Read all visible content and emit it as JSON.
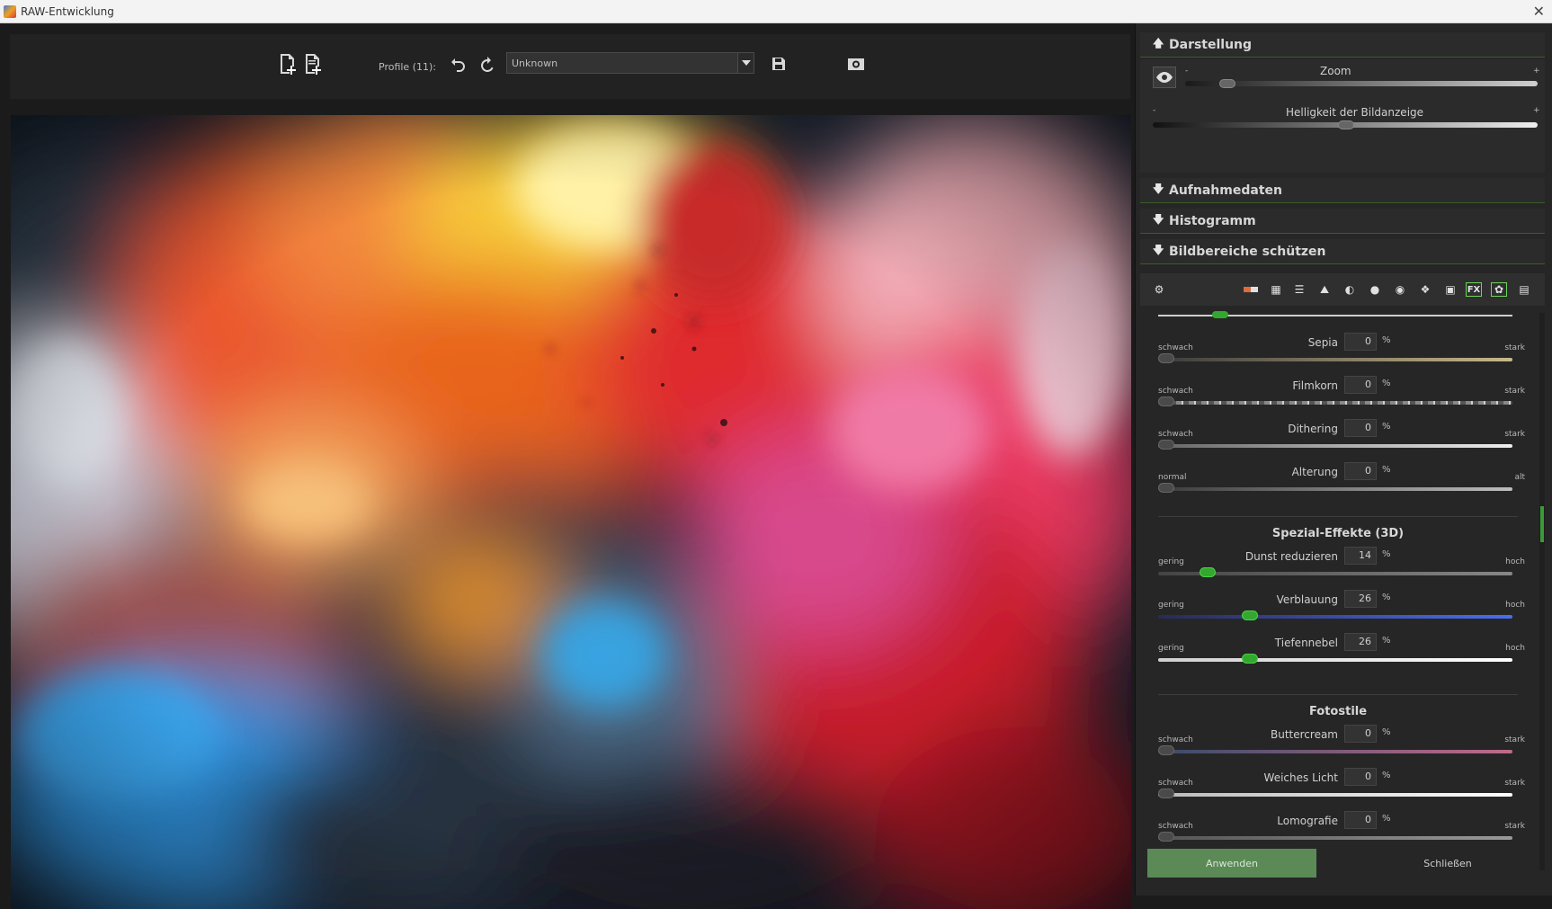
{
  "window": {
    "title": "RAW-Entwicklung",
    "close_glyph": "✕"
  },
  "toolbar": {
    "profile_label": "Profile (11):",
    "profile_value": "Unknown",
    "icons": [
      "add-file-icon",
      "add-copy-icon",
      "undo-icon",
      "redo-icon",
      "save-icon",
      "camera-icon"
    ]
  },
  "panel": {
    "darstellung": {
      "title": "Darstellung",
      "zoom_label": "Zoom",
      "zoom_minus": "-",
      "zoom_plus": "+",
      "brightness_label": "Helligkeit der Bildanzeige",
      "brightness_minus": "-",
      "brightness_plus": "+"
    },
    "aufnahmedaten": {
      "title": "Aufnahmedaten"
    },
    "histogramm": {
      "title": "Histogramm"
    },
    "bildbereiche": {
      "title": "Bildbereiche schützen"
    },
    "effects": [
      {
        "name": "Sepia",
        "value": "0",
        "unit": "%",
        "low": "schwach",
        "high": "stark",
        "level": 0
      },
      {
        "name": "Filmkorn",
        "value": "0",
        "unit": "%",
        "low": "schwach",
        "high": "stark",
        "level": 0
      },
      {
        "name": "Dithering",
        "value": "0",
        "unit": "%",
        "low": "schwach",
        "high": "stark",
        "level": 0
      },
      {
        "name": "Alterung",
        "value": "0",
        "unit": "%",
        "low": "normal",
        "high": "alt",
        "level": 0
      }
    ],
    "special_title": "Spezial-Effekte (3D)",
    "special": [
      {
        "name": "Dunst reduzieren",
        "value": "14",
        "unit": "%",
        "low": "gering",
        "high": "hoch",
        "level": 14
      },
      {
        "name": "Verblauung",
        "value": "26",
        "unit": "%",
        "low": "gering",
        "high": "hoch",
        "level": 26
      },
      {
        "name": "Tiefennebel",
        "value": "26",
        "unit": "%",
        "low": "gering",
        "high": "hoch",
        "level": 26
      }
    ],
    "fotostile_title": "Fotostile",
    "fotostile": [
      {
        "name": "Buttercream",
        "value": "0",
        "unit": "%",
        "low": "schwach",
        "high": "stark",
        "level": 0
      },
      {
        "name": "Weiches Licht",
        "value": "0",
        "unit": "%",
        "low": "schwach",
        "high": "stark",
        "level": 0
      },
      {
        "name": "Lomografie",
        "value": "0",
        "unit": "%",
        "low": "schwach",
        "high": "stark",
        "level": 0
      }
    ],
    "apply_label": "Anwenden",
    "close_label": "Schließen"
  }
}
